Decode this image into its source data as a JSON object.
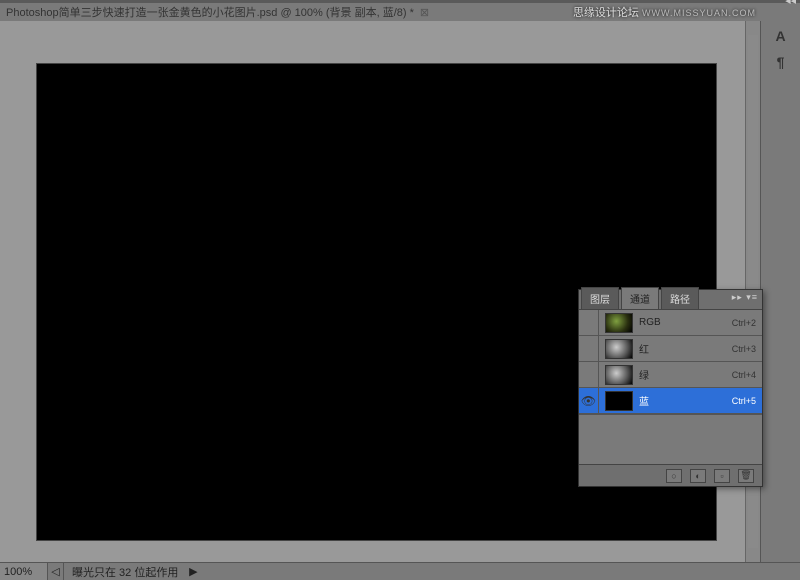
{
  "titlebar": {
    "doc_title": "Photoshop简单三步快速打造一张金黄色的小花图片.psd @ 100% (背景 副本, 蓝/8) *",
    "close_glyph": "⊠"
  },
  "watermark": {
    "name": "思缘设计论坛",
    "url": "WWW.MISSYUAN.COM"
  },
  "rightbar": {
    "tool_text": "A",
    "tool_para": "¶"
  },
  "panel": {
    "tabs": {
      "layers": "图层",
      "channels": "通道",
      "paths": "路径"
    },
    "menu_glyph": "▸▸ ▾≡",
    "channels": [
      {
        "name": "RGB",
        "shortcut": "Ctrl+2",
        "thumb": "rgb",
        "visible": false,
        "selected": false
      },
      {
        "name": "红",
        "shortcut": "Ctrl+3",
        "thumb": "gray",
        "visible": false,
        "selected": false
      },
      {
        "name": "绿",
        "shortcut": "Ctrl+4",
        "thumb": "gray",
        "visible": false,
        "selected": false
      },
      {
        "name": "蓝",
        "shortcut": "Ctrl+5",
        "thumb": "black",
        "visible": true,
        "selected": true
      }
    ],
    "footer": {
      "load_sel": "○",
      "save_sel": "◐",
      "new_ch": "▫",
      "delete": "🗑"
    }
  },
  "statusbar": {
    "zoom": "100%",
    "arrow_left": "◁",
    "info": "曝光只在 32 位起作用",
    "play": "▶"
  }
}
